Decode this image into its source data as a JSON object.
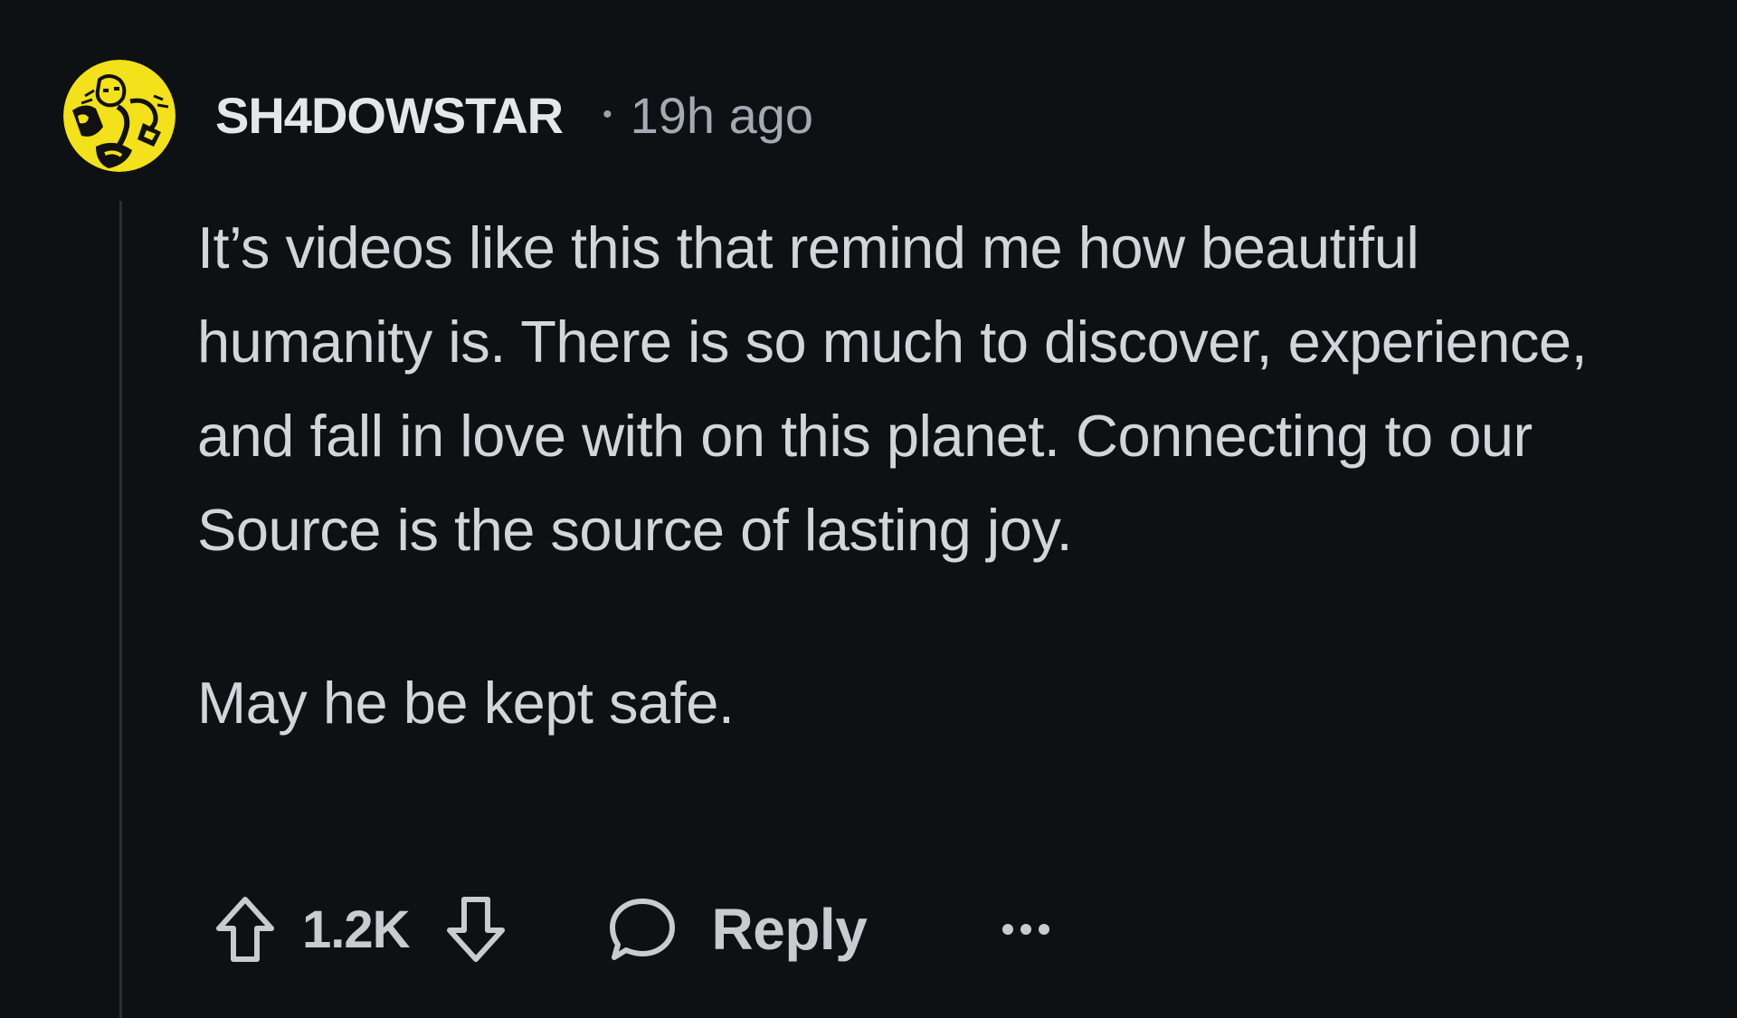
{
  "comment": {
    "avatar_icon": "comic-avatar-icon",
    "avatar_color": "#f2e11b",
    "username": "SH4DOWSTAR",
    "separator": "•",
    "timestamp": "19h ago",
    "paragraphs": [
      "It’s videos like this that remind me how beautiful humanity is. There is so much to discover, experience, and fall in love with on this planet. Connecting to our Source is the source of lasting joy.",
      "May he be kept safe."
    ],
    "actions": {
      "upvote_icon": "arrow-up-icon",
      "vote_count": "1.2K",
      "downvote_icon": "arrow-down-icon",
      "reply_icon": "speech-bubble-icon",
      "reply_label": "Reply",
      "more_icon": "ellipsis-icon"
    }
  }
}
